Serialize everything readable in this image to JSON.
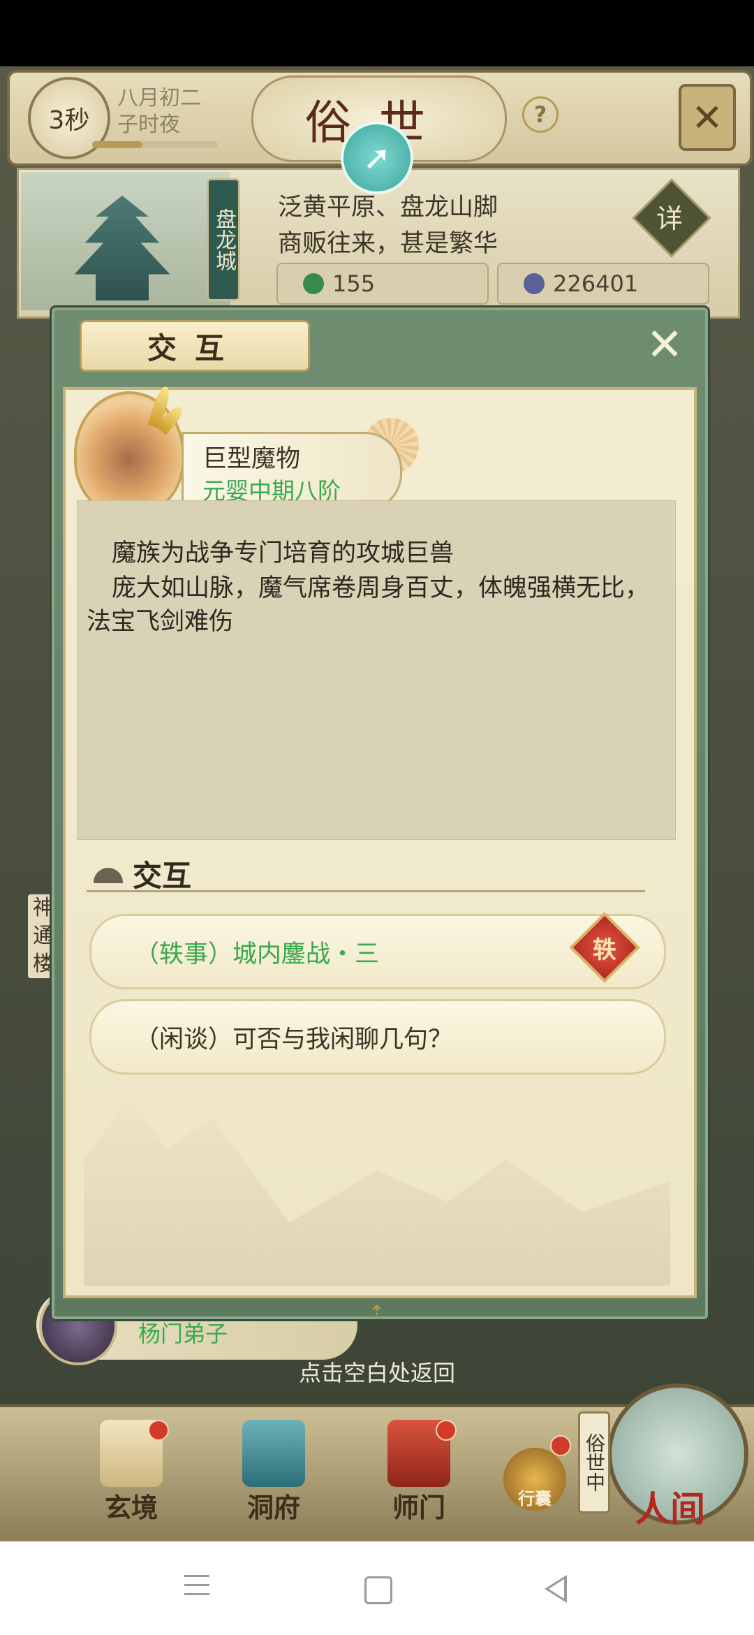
{
  "header": {
    "timer": "3秒",
    "date": "八月初二",
    "time_of_day": "子时夜",
    "title": "俗世",
    "help": "?",
    "close": "✕"
  },
  "location": {
    "city_name": "盘龙城",
    "line1": "泛黄平原、盘龙山脚",
    "line2": "商贩往来，甚是繁华",
    "detail_btn": "详",
    "resource1": "155",
    "resource2": "226401"
  },
  "modal": {
    "title": "交互",
    "close": "✕",
    "enemy_name": "巨型魔物",
    "enemy_rank": "元婴中期八阶",
    "desc_line1": "魔族为战争专门培育的攻城巨兽",
    "desc_line2": "庞大如山脉，魔气席卷周身百丈，体魄强横无比，法宝飞剑难伤",
    "section_title": "交互",
    "options": [
      {
        "label": "（轶事）城内鏖战・三",
        "badge": "轶"
      },
      {
        "label": "（闲谈）可否与我闲聊几句？"
      }
    ]
  },
  "background": {
    "side_label": "神通楼",
    "disciple_name": "杨门弟子",
    "back_hint": "点击空白处返回"
  },
  "bottom_nav": {
    "items": [
      {
        "label": "玄境"
      },
      {
        "label": "洞府"
      },
      {
        "label": "师门"
      },
      {
        "label": "行囊"
      }
    ],
    "current_tag": "俗世中",
    "main": "人间"
  },
  "colors": {
    "accent_green": "#3aa94c",
    "modal_frame": "#6f8d70",
    "badge_red": "#b3291f"
  }
}
